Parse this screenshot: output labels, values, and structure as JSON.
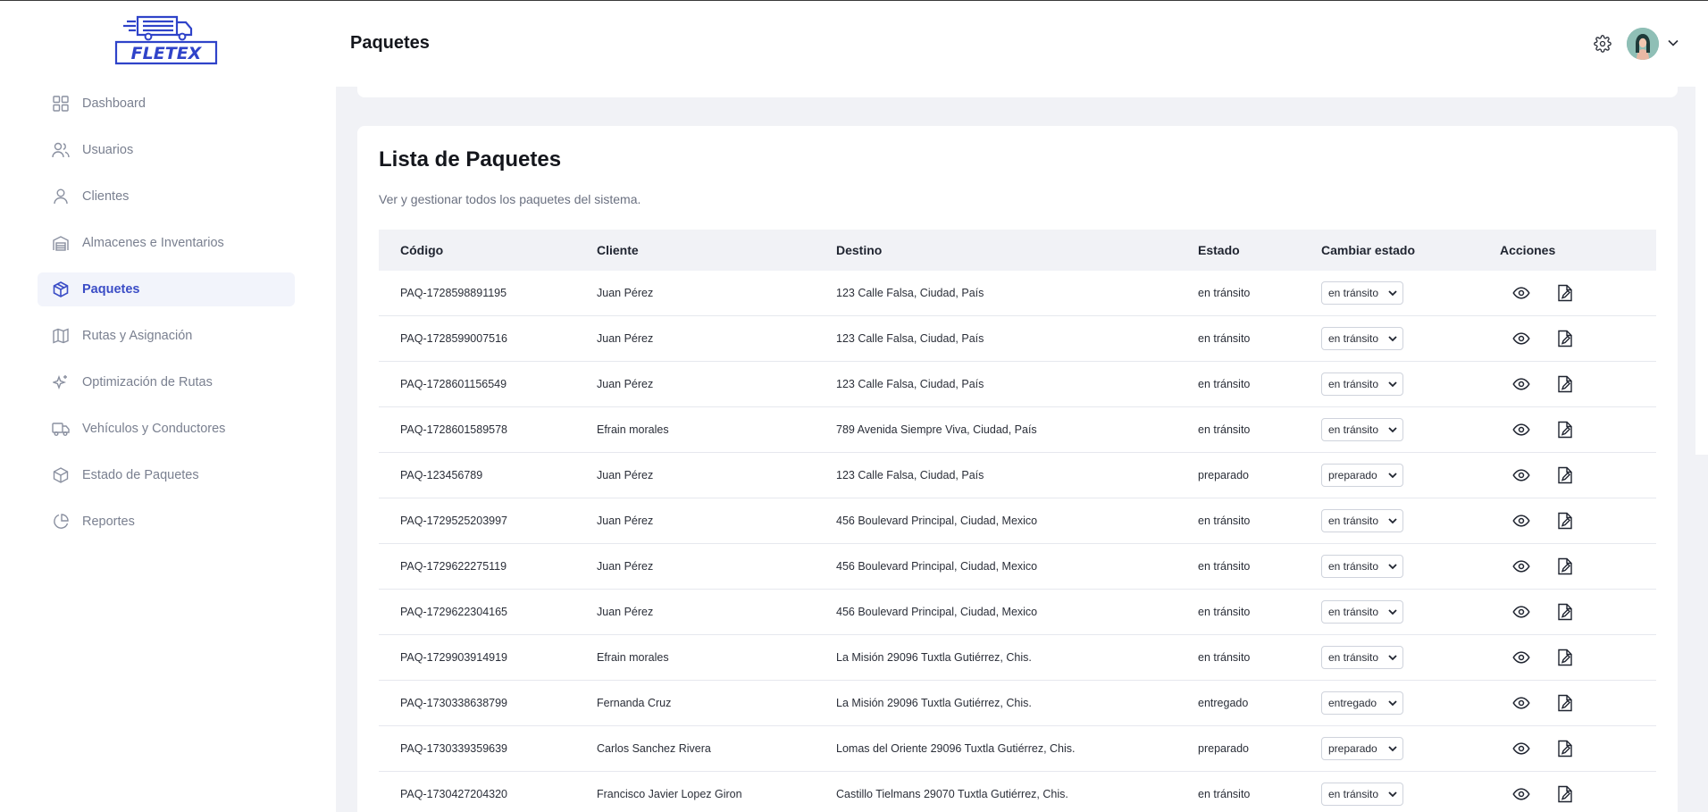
{
  "app": {
    "logo_text": "FLETEX",
    "colors": {
      "accent": "#3b4dc6",
      "logo": "#2f43c9",
      "muted": "#7a8090",
      "background": "#f1f2f6"
    }
  },
  "sidebar": {
    "items": [
      {
        "label": "Dashboard",
        "icon": "grid-icon",
        "active": false
      },
      {
        "label": "Usuarios",
        "icon": "users-icon",
        "active": false
      },
      {
        "label": "Clientes",
        "icon": "user-icon",
        "active": false
      },
      {
        "label": "Almacenes e Inventarios",
        "icon": "warehouse-icon",
        "active": false
      },
      {
        "label": "Paquetes",
        "icon": "package-icon",
        "active": true
      },
      {
        "label": "Rutas y Asignación",
        "icon": "map-icon",
        "active": false
      },
      {
        "label": "Optimización de Rutas",
        "icon": "sparkles-icon",
        "active": false
      },
      {
        "label": "Vehículos y Conductores",
        "icon": "truck-icon",
        "active": false
      },
      {
        "label": "Estado de Paquetes",
        "icon": "package-status-icon",
        "active": false
      },
      {
        "label": "Reportes",
        "icon": "pie-chart-icon",
        "active": false
      }
    ]
  },
  "header": {
    "title": "Paquetes",
    "settings_icon": "gear-icon",
    "avatar_icon": "avatar",
    "menu_icon": "chevron-down-icon"
  },
  "card": {
    "title": "Lista de Paquetes",
    "subtitle": "Ver y gestionar todos los paquetes del sistema.",
    "columns": [
      "Código",
      "Cliente",
      "Destino",
      "Estado",
      "Cambiar estado",
      "Acciones"
    ],
    "rows": [
      {
        "codigo": "PAQ-1728598891195",
        "cliente": "Juan Pérez",
        "destino": "123 Calle Falsa, Ciudad, País",
        "estado": "en tránsito",
        "select": "en tránsito"
      },
      {
        "codigo": "PAQ-1728599007516",
        "cliente": "Juan Pérez",
        "destino": "123 Calle Falsa, Ciudad, País",
        "estado": "en tránsito",
        "select": "en tránsito"
      },
      {
        "codigo": "PAQ-1728601156549",
        "cliente": "Juan Pérez",
        "destino": "123 Calle Falsa, Ciudad, País",
        "estado": "en tránsito",
        "select": "en tránsito"
      },
      {
        "codigo": "PAQ-1728601589578",
        "cliente": "Efrain morales",
        "destino": "789 Avenida Siempre Viva, Ciudad, País",
        "estado": "en tránsito",
        "select": "en tránsito"
      },
      {
        "codigo": "PAQ-123456789",
        "cliente": "Juan Pérez",
        "destino": "123 Calle Falsa, Ciudad, País",
        "estado": "preparado",
        "select": "preparado"
      },
      {
        "codigo": "PAQ-1729525203997",
        "cliente": "Juan Pérez",
        "destino": "456 Boulevard Principal, Ciudad, Mexico",
        "estado": "en tránsito",
        "select": "en tránsito"
      },
      {
        "codigo": "PAQ-1729622275119",
        "cliente": "Juan Pérez",
        "destino": "456 Boulevard Principal, Ciudad, Mexico",
        "estado": "en tránsito",
        "select": "en tránsito"
      },
      {
        "codigo": "PAQ-1729622304165",
        "cliente": "Juan Pérez",
        "destino": "456 Boulevard Principal, Ciudad, Mexico",
        "estado": "en tránsito",
        "select": "en tránsito"
      },
      {
        "codigo": "PAQ-1729903914919",
        "cliente": "Efrain morales",
        "destino": "La Misión 29096 Tuxtla Gutiérrez, Chis.",
        "estado": "en tránsito",
        "select": "en tránsito"
      },
      {
        "codigo": "PAQ-1730338638799",
        "cliente": "Fernanda Cruz",
        "destino": "La Misión 29096 Tuxtla Gutiérrez, Chis.",
        "estado": "entregado",
        "select": "entregado"
      },
      {
        "codigo": "PAQ-1730339359639",
        "cliente": "Carlos Sanchez Rivera",
        "destino": "Lomas del Oriente 29096 Tuxtla Gutiérrez, Chis.",
        "estado": "preparado",
        "select": "preparado"
      },
      {
        "codigo": "PAQ-1730427204320",
        "cliente": "Francisco Javier Lopez Giron",
        "destino": "Castillo Tielmans 29070 Tuxtla Gutiérrez, Chis.",
        "estado": "en tránsito",
        "select": "en tránsito"
      }
    ]
  }
}
